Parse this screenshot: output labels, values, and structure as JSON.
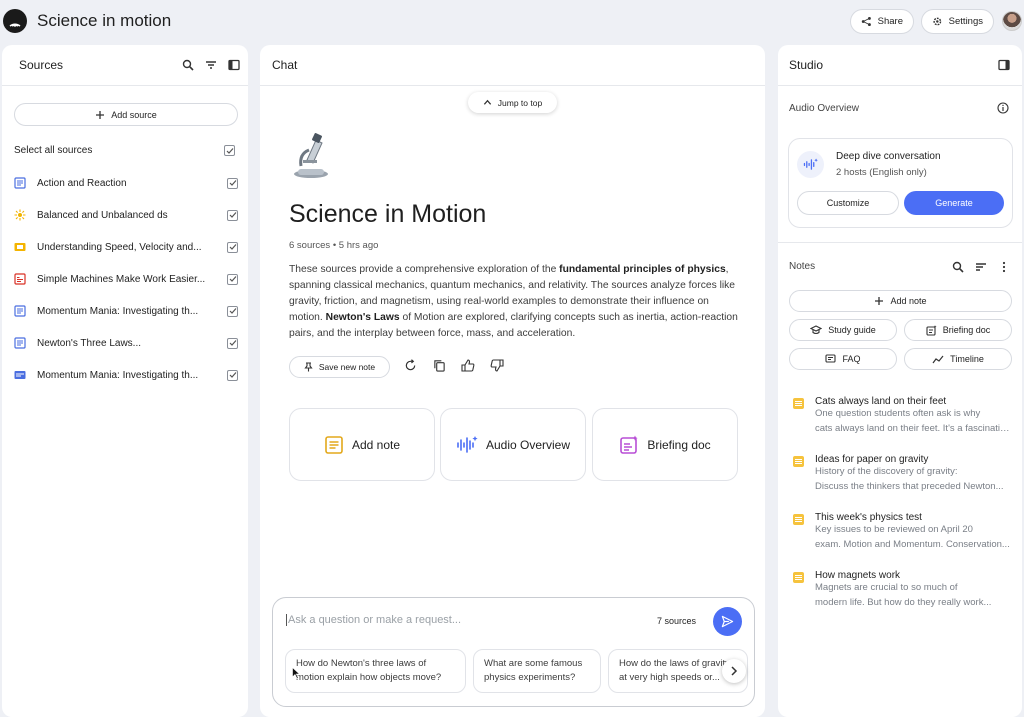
{
  "app": {
    "title": "Science in motion"
  },
  "header": {
    "share_label": "Share",
    "settings_label": "Settings"
  },
  "sources": {
    "title": "Sources",
    "add_label": "Add source",
    "select_all_label": "Select all sources",
    "items": [
      {
        "label": "Action and Reaction",
        "icon": "doc-icon",
        "color": "#4a6ee0"
      },
      {
        "label": "Balanced and Unbalanced ds",
        "icon": "web-icon",
        "color": "#f1b400"
      },
      {
        "label": "Understanding Speed, Velocity and...",
        "icon": "slides-icon",
        "color": "#f4b400"
      },
      {
        "label": "Simple Machines Make Work Easier...",
        "icon": "pdf-icon",
        "color": "#d93025"
      },
      {
        "label": "Momentum Mania: Investigating th...",
        "icon": "doc-icon",
        "color": "#4a6ee0"
      },
      {
        "label": "Newton's Three Laws...",
        "icon": "doc-icon",
        "color": "#4a6ee0"
      },
      {
        "label": "Momentum Mania: Investigating th...",
        "icon": "video-icon",
        "color": "#4a6ee0"
      }
    ]
  },
  "chat": {
    "title": "Chat",
    "jump_label": "Jump to top",
    "notebook_title": "Science in Motion",
    "meta": "6 sources • 5 hrs ago",
    "summary": {
      "p1": "These sources provide a comprehensive exploration of the ",
      "b1": "fundamental principles of physics",
      "p2": ", spanning classical mechanics, quantum mechanics, and relativity. The sources analyze forces like gravity, friction, and magnetism, using real-world examples to demonstrate their influence on motion. ",
      "b2": "Newton's Laws",
      "p3": " of Motion are explored, clarifying concepts such as inertia, action-reaction pairs, and the interplay between force, mass, and acceleration."
    },
    "save_note_label": "Save new note",
    "cards": [
      {
        "label": "Add note"
      },
      {
        "label": "Audio Overview"
      },
      {
        "label": "Briefing doc"
      }
    ],
    "input_placeholder": "Ask a question or make a request...",
    "source_count": "7 sources",
    "suggestions": [
      {
        "line1": "How do Newton's three laws of",
        "line2": "motion explain how objects move?"
      },
      {
        "line1": "What are some famous",
        "line2": "physics experiments?"
      },
      {
        "line1": "How do the laws of gravity",
        "line2": "at very high speeds or..."
      }
    ]
  },
  "studio": {
    "title": "Studio",
    "audio_overview_label": "Audio Overview",
    "deep_dive_title": "Deep dive conversation",
    "deep_dive_sub": "2 hosts (English only)",
    "customize_label": "Customize",
    "generate_label": "Generate",
    "notes_label": "Notes",
    "add_note_label": "Add note",
    "study_guide_label": "Study guide",
    "briefing_doc_label": "Briefing doc",
    "faq_label": "FAQ",
    "timeline_label": "Timeline",
    "notes": [
      {
        "title": "Cats always land on their feet",
        "line1": "One question students often ask is why",
        "line2": "cats always land on their feet. It's a fascinating..."
      },
      {
        "title": "Ideas for paper on gravity",
        "line1": "History of the discovery of gravity:",
        "line2": "Discuss the thinkers that preceded Newton..."
      },
      {
        "title": "This week's physics test",
        "line1": "Key issues to be reviewed on April 20",
        "line2": "exam. Motion and Momentum. Conservation..."
      },
      {
        "title": "How magnets work",
        "line1": "Magnets are crucial to so much of",
        "line2": "modern life. But how do they really work..."
      }
    ]
  },
  "colors": {
    "accent": "#4b6ef5",
    "note_icon": "#f6c33d",
    "background": "#eef0f5"
  }
}
